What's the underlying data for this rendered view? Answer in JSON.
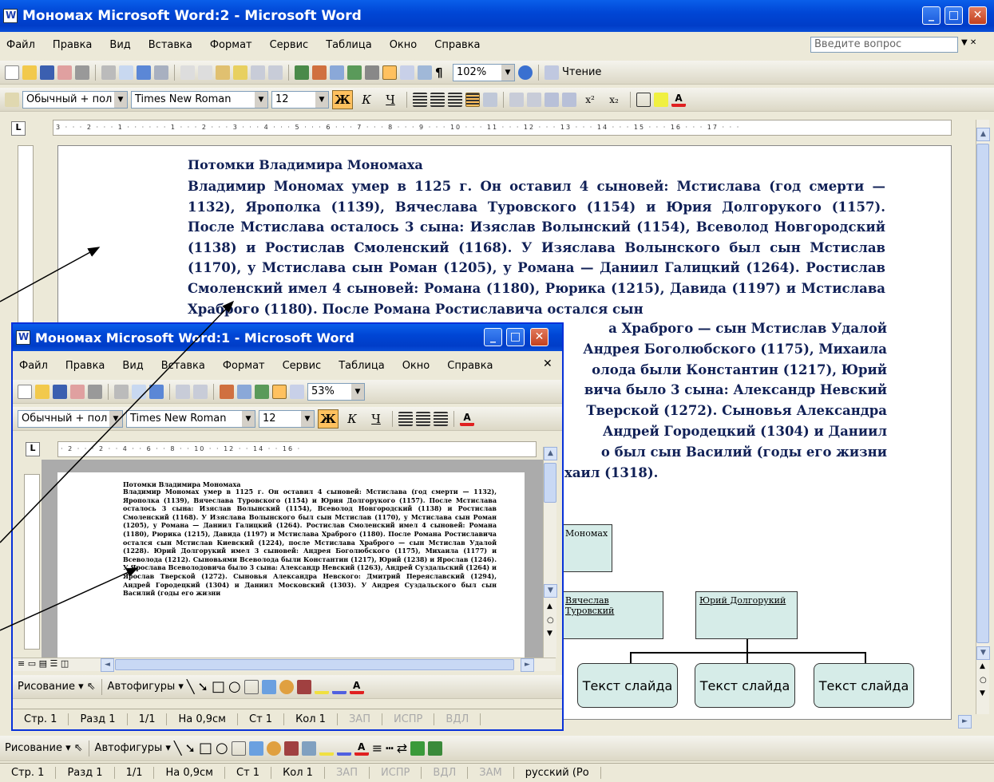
{
  "main_window": {
    "title": "Мономах Microsoft Word:2 - Microsoft Word",
    "menu": [
      "Файл",
      "Правка",
      "Вид",
      "Вставка",
      "Формат",
      "Сервис",
      "Таблица",
      "Окно",
      "Справка"
    ],
    "help_placeholder": "Введите вопрос",
    "zoom": "102%",
    "reading_label": "Чтение",
    "style": "Обычный + пол",
    "font": "Times New Roman",
    "font_size": "12",
    "ruler": "3 · · · 2 · · · 1 · · ·  · · · 1 · · · 2 · · · 3 · · · 4 · · · 5 · · · 6 · · · 7 · · · 8 · · · 9 · · · 10 · · · 11 · · · 12 · · · 13 · · · 14 · · · 15 · · · 16 · · · 17 · · ·",
    "doc_title": "Потомки Владимира Мономаха",
    "doc_body": "Владимир Мономах умер в 1125 г. Он оставил 4 сыновей: Мстислава (год смерти — 1132), Ярополка (1139), Вячеслава Туровского (1154) и Юрия Долгорукого (1157). После Мстислава осталось 3 сына: Изяслав Волынский (1154), Всеволод Новгородский (1138) и Ростислав Смоленский (1168). У Изяслава Волынского был сын Мстислав (1170), у Мстислава сын Роман (1205), у Романа — Даниил Галицкий (1264). Ростислав Смоленский имел 4 сыновей: Романа (1180), Рюрика (1215), Давида (1197) и Мстислава Храброго (1180). После Романа Ростиславича остался сын",
    "doc_right_lines": [
      "а Храброго — сын Мстислав Удалой",
      "Андрея Боголюбского (1175), Михаила",
      "олода были Константин (1217), Юрий",
      "вича было 3 сына: Александр Невский",
      "Тверской (1272). Сыновья Александра",
      "Андрей Городецкий (1304) и Даниил",
      "о был сын Василий (годы его жизни",
      "хаил (1318)."
    ],
    "org_top": "Мономах",
    "org_mid_left": "Вячеслав Туровский",
    "org_mid_right": "Юрий Долгорукий",
    "slide_boxes": [
      "Текст слайда",
      "Текст слайда",
      "Текст слайда"
    ],
    "drawing": "Рисование",
    "autoshapes": "Автофигуры",
    "status": {
      "page": "Стр. 1",
      "section": "Разд 1",
      "pages": "1/1",
      "at": "На 0,9см",
      "line": "Ст 1",
      "col": "Кол 1",
      "rec": "ЗАП",
      "trk": "ИСПР",
      "ext": "ВДЛ",
      "ovr": "ЗАМ",
      "lang": "русский (Ро"
    }
  },
  "inner_window": {
    "title": "Мономах Microsoft Word:1 - Microsoft Word",
    "menu": [
      "Файл",
      "Правка",
      "Вид",
      "Вставка",
      "Формат",
      "Сервис",
      "Таблица",
      "Окно",
      "Справка"
    ],
    "zoom": "53%",
    "style": "Обычный + пол",
    "font": "Times New Roman",
    "font_size": "12",
    "ruler": "· 2 ·  · · 2 · · 4 · · 6 · · 8 · · 10 · · 12 · · 14 · · 16 ·",
    "doc_title": "Потомки Владимира Мономаха",
    "doc_body": "Владимир Мономах умер в 1125 г. Он оставил 4 сыновей: Мстислава (год смерти — 1132), Ярополка (1139), Вячеслава Туровского (1154) и Юрия Долгорукого (1157). После Мстислава осталось 3 сына: Изяслав Волынский (1154), Всеволод Новгородский (1138) и Ростислав Смоленский (1168). У Изяслава Волынского был сын Мстислав (1170), у Мстислава сын Роман (1205), у Романа — Даниил Галицкий (1264). Ростислав Смоленский имел 4 сыновей: Романа (1180), Рюрика (1215), Давида (1197) и Мстислава Храброго (1180). После Романа Ростиславича остался сын Мстислав Киевский (1224), после Мстислава Храброго — сын Мстислав Удалой (1228). Юрий Долгорукий имел 3 сыновей: Андрея Боголюбского (1175), Михаила (1177) и Всеволода (1212). Сыновьями Всеволода были Константин (1217), Юрий (1238) и Ярослав (1246). У Ярослава Всеволодовича было 3 сына: Александр Невский (1263), Андрей Суздальский (1264) и Ярослав Тверской (1272). Сыновья Александра Невского: Дмитрий Переяславский (1294), Андрей Городецкий (1304) и Даниил Московский (1303). У Андрея Суздальского был сын Василий (годы его жизни",
    "drawing": "Рисование",
    "autoshapes": "Автофигуры",
    "status": {
      "page": "Стр. 1",
      "section": "Разд 1",
      "pages": "1/1",
      "at": "На 0,9см",
      "line": "Ст 1",
      "col": "Кол 1",
      "rec": "ЗАП",
      "trk": "ИСПР",
      "ext": "ВДЛ"
    }
  }
}
